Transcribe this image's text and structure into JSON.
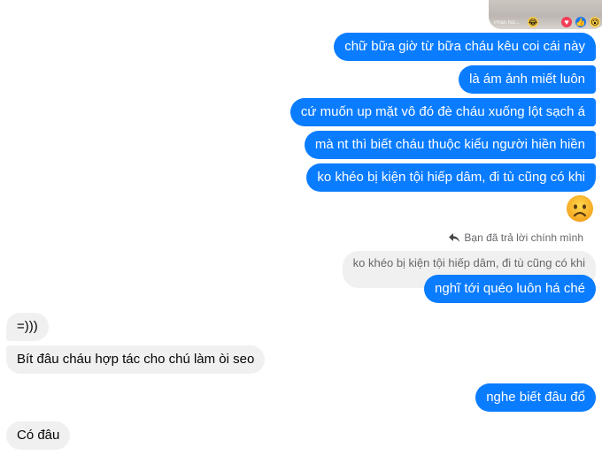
{
  "media_preview": {
    "caption": "Phản hồi..."
  },
  "messages": {
    "m1": "chữ bữa giờ từ bữa cháu kêu coi cái này",
    "m2": "là ám ảnh miết luôn",
    "m3": "cứ muốn up mặt vô đó đè cháu xuống lột sạch á",
    "m4": "mà nt thì biết cháu thuộc kiểu người hiền hiền",
    "m5": "ko khéo bị kiện tội hiếp dâm, đi tù cũng có khi",
    "reply_label": "Bạn đã trả lời chính mình",
    "quoted": "ko khéo bị kiện tội hiếp dâm, đi tù cũng có khi",
    "m6": "nghĩ tới quéo luôn há ché",
    "r1": "=)))",
    "r2": "Bít đâu cháu hợp tác cho chú làm òi seo",
    "m7": "nghe biết đâu đổ",
    "r3": "Có đâu"
  },
  "icons": {
    "reaction": "frowning-face-emoji",
    "reply": "reply-arrow-icon"
  },
  "colors": {
    "outgoing_bubble": "#0a7cff",
    "incoming_bubble": "#f0f0f0"
  }
}
